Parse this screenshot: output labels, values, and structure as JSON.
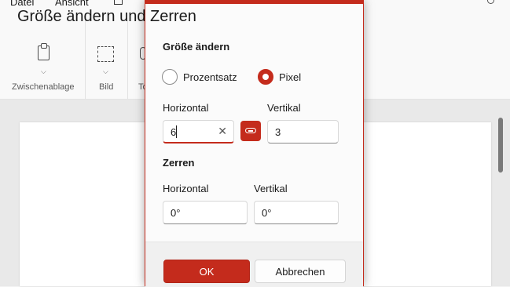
{
  "menubar": {
    "file": "Datei",
    "view": "Ansicht"
  },
  "ribbon": {
    "groups": [
      {
        "label": "Zwischenablage"
      },
      {
        "label": "Bild"
      },
      {
        "label": "To"
      }
    ]
  },
  "dialog": {
    "title": "Größe ändern und Zerren",
    "resize": {
      "heading": "Größe ändern",
      "options": [
        {
          "label": "Prozentsatz",
          "selected": false
        },
        {
          "label": "Pixel",
          "selected": true
        }
      ],
      "horizontal_label": "Horizontal",
      "vertical_label": "Vertikal",
      "horizontal_value": "6",
      "vertical_value": "3"
    },
    "skew": {
      "heading": "Zerren",
      "horizontal_label": "Horizontal",
      "vertical_label": "Vertikal",
      "horizontal_value": "0°",
      "vertical_value": "0°"
    },
    "ok": "OK",
    "cancel": "Abbrechen"
  },
  "colors": {
    "accent": "#c42b1c"
  }
}
